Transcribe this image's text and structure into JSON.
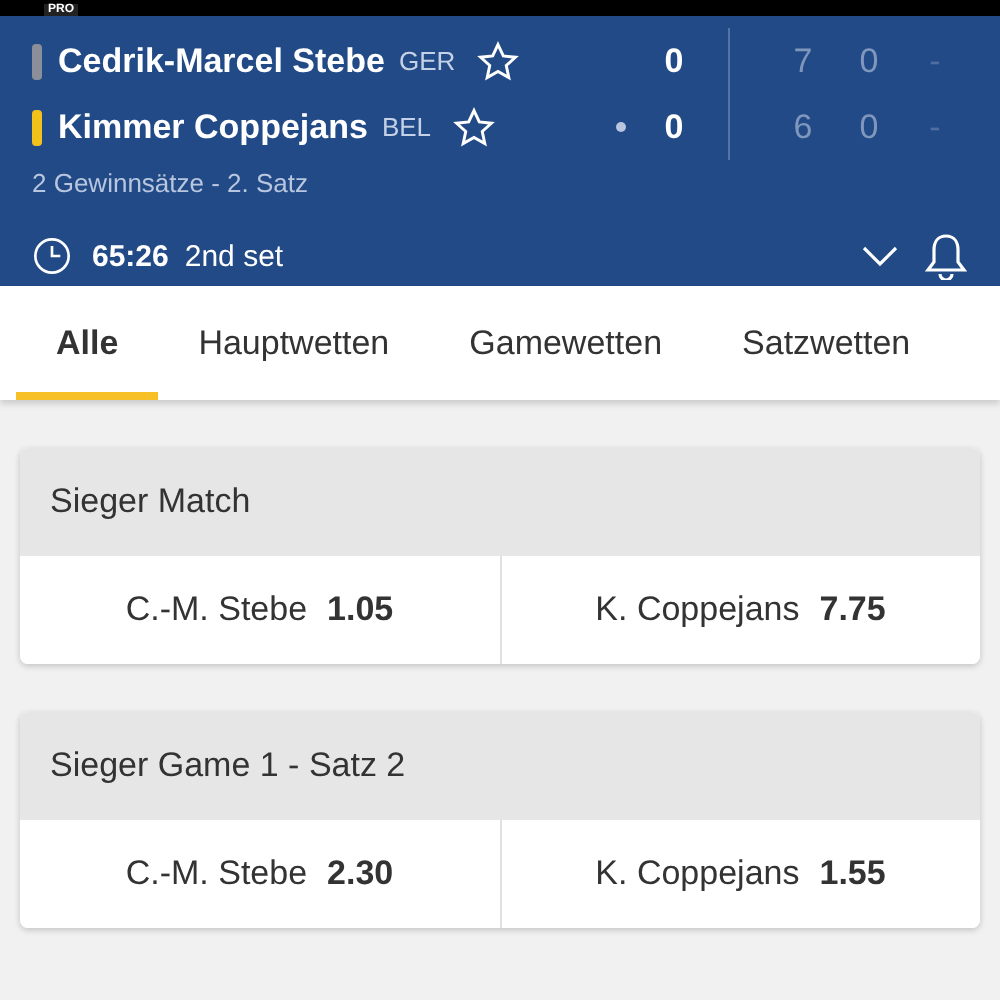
{
  "badge": "PRO",
  "players": [
    {
      "name": "Cedrik-Marcel Stebe",
      "country": "GER",
      "color": "#8a8f99",
      "serving": false,
      "points": "0",
      "sets": [
        "7",
        "0",
        "-"
      ]
    },
    {
      "name": "Kimmer Coppejans",
      "country": "BEL",
      "color": "#f2c21b",
      "serving": true,
      "points": "0",
      "sets": [
        "6",
        "0",
        "-"
      ]
    }
  ],
  "match_info": "2 Gewinnsätze - 2. Satz",
  "time": "65:26",
  "period": "2nd set",
  "tabs": [
    {
      "label": "Alle",
      "selected": true
    },
    {
      "label": "Hauptwetten",
      "selected": false
    },
    {
      "label": "Gamewetten",
      "selected": false
    },
    {
      "label": "Satzwetten",
      "selected": false
    }
  ],
  "markets": [
    {
      "title": "Sieger Match",
      "odds": [
        {
          "name": "C.-M. Stebe",
          "value": "1.05"
        },
        {
          "name": "K. Coppejans",
          "value": "7.75"
        }
      ]
    },
    {
      "title": "Sieger Game 1 - Satz 2",
      "odds": [
        {
          "name": "C.-M. Stebe",
          "value": "2.30"
        },
        {
          "name": "K. Coppejans",
          "value": "1.55"
        }
      ]
    }
  ]
}
